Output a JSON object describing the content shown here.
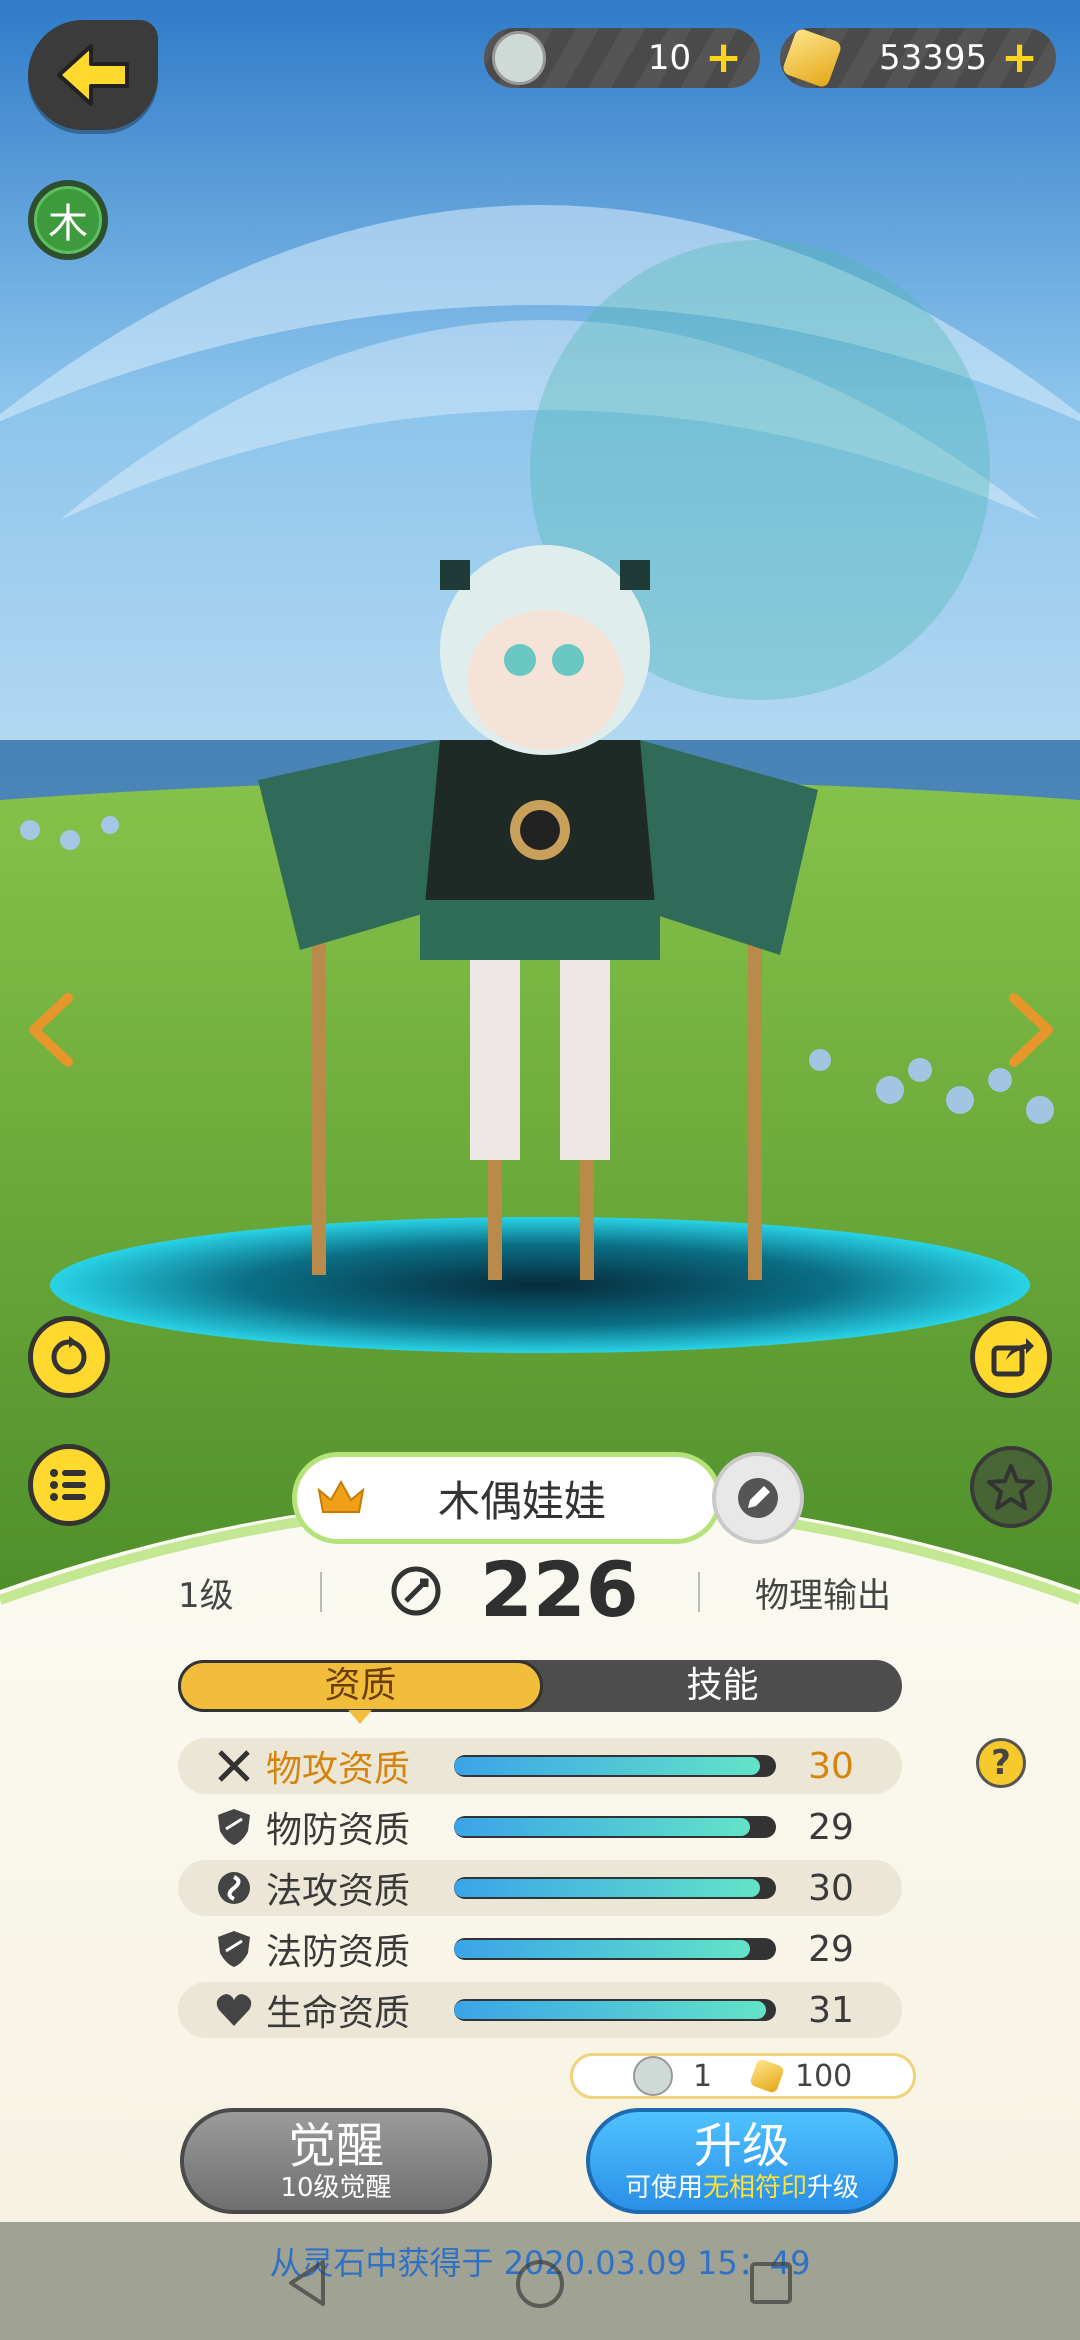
{
  "top_bar": {
    "back_icon": "arrow-left-icon",
    "soul_currency": {
      "icon": "doll-face-icon",
      "value": "10",
      "plus": "+"
    },
    "crystal_currency": {
      "icon": "gold-crystal-icon",
      "value": "53395",
      "plus": "+"
    }
  },
  "element_badge": {
    "label": "木",
    "color": "#3d9a3d"
  },
  "character": {
    "name": "木偶娃娃"
  },
  "summary": {
    "level": "1级",
    "power": "226",
    "role": "物理输出"
  },
  "tabs": [
    {
      "label": "资质",
      "active": true
    },
    {
      "label": "技能",
      "active": false
    }
  ],
  "attributes": [
    {
      "icon": "sword-cross-icon",
      "label": "物攻资质",
      "value": "30",
      "fill": 0.95,
      "highlight": true
    },
    {
      "icon": "shield-icon",
      "label": "物防资质",
      "value": "29",
      "fill": 0.92,
      "highlight": false
    },
    {
      "icon": "magic-swirl-icon",
      "label": "法攻资质",
      "value": "30",
      "fill": 0.95,
      "highlight": false
    },
    {
      "icon": "shield-icon",
      "label": "法防资质",
      "value": "29",
      "fill": 0.92,
      "highlight": false
    },
    {
      "icon": "heart-icon",
      "label": "生命资质",
      "value": "31",
      "fill": 0.97,
      "highlight": false
    }
  ],
  "help": {
    "label": "?"
  },
  "cost": {
    "doll_amount": "1",
    "crystal_amount": "100"
  },
  "buttons": {
    "awaken": {
      "label": "觉醒",
      "sub": "10级觉醒"
    },
    "upgrade": {
      "label": "升级",
      "sub_prefix": "可使用",
      "sub_highlight": "无相符印",
      "sub_suffix": "升级"
    }
  },
  "source": {
    "text": "从灵石中获得于 2020.03.09   15：49"
  },
  "colors": {
    "accent": "#f2bd3b",
    "bar_start": "#3aa4e8",
    "bar_end": "#63e3c8",
    "highlight_text": "#d5850e",
    "upgrade": "#2a8fe8"
  }
}
